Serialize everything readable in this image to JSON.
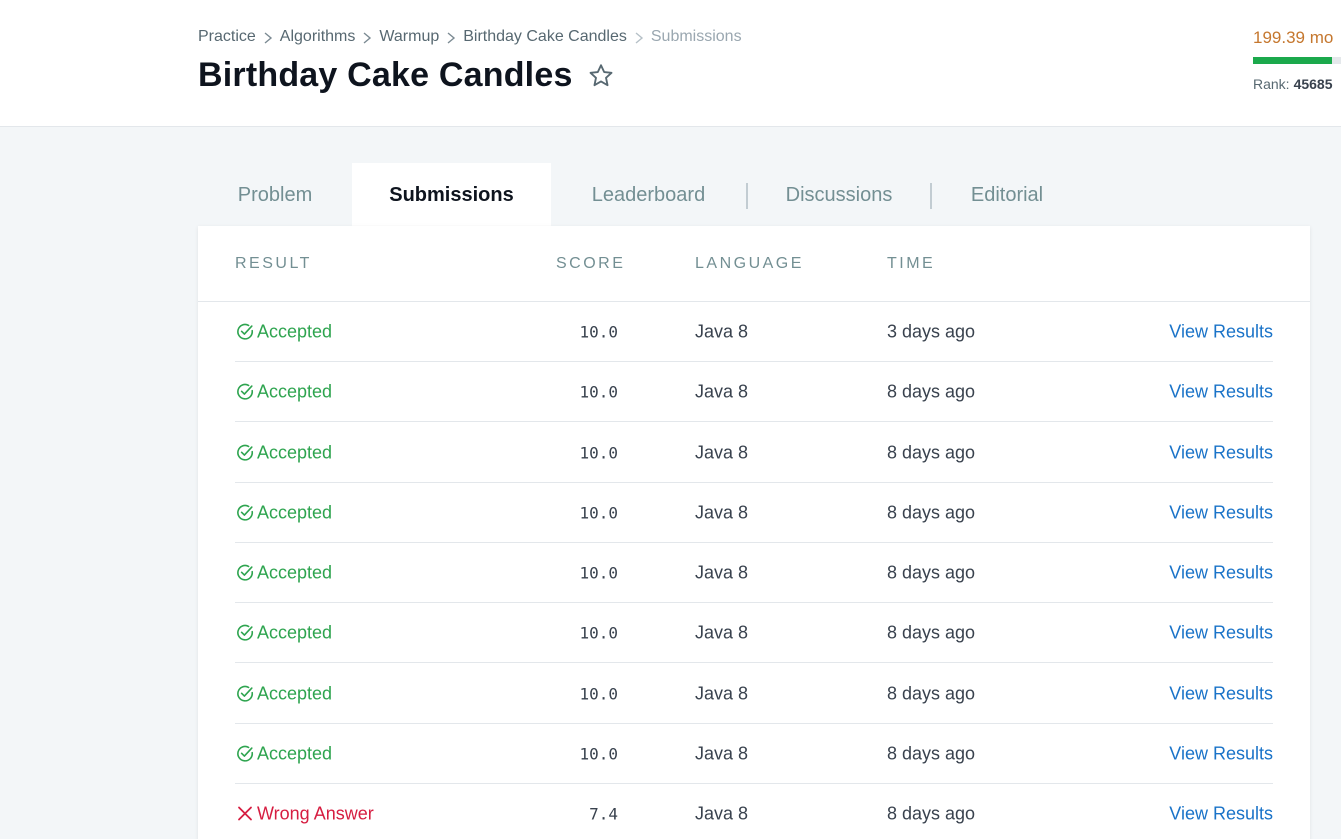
{
  "breadcrumb": [
    "Practice",
    "Algorithms",
    "Warmup",
    "Birthday Cake Candles",
    "Submissions"
  ],
  "page_title": "Birthday Cake Candles",
  "user_stats": {
    "points_text": "199.39 mo",
    "progress_fraction": 0.9,
    "rank_label": "Rank:",
    "rank_value": "45685"
  },
  "tabs": [
    {
      "label": "Problem",
      "active": false
    },
    {
      "label": "Submissions",
      "active": true
    },
    {
      "label": "Leaderboard",
      "active": false
    },
    {
      "label": "Discussions",
      "active": false
    },
    {
      "label": "Editorial",
      "active": false
    }
  ],
  "table": {
    "headers": [
      "RESULT",
      "SCORE",
      "LANGUAGE",
      "TIME"
    ],
    "rows": [
      {
        "result": "Accepted",
        "status": "accepted",
        "score": "10.0",
        "language": "Java 8",
        "time": "3 days ago",
        "action": "View Results"
      },
      {
        "result": "Accepted",
        "status": "accepted",
        "score": "10.0",
        "language": "Java 8",
        "time": "8 days ago",
        "action": "View Results"
      },
      {
        "result": "Accepted",
        "status": "accepted",
        "score": "10.0",
        "language": "Java 8",
        "time": "8 days ago",
        "action": "View Results"
      },
      {
        "result": "Accepted",
        "status": "accepted",
        "score": "10.0",
        "language": "Java 8",
        "time": "8 days ago",
        "action": "View Results"
      },
      {
        "result": "Accepted",
        "status": "accepted",
        "score": "10.0",
        "language": "Java 8",
        "time": "8 days ago",
        "action": "View Results"
      },
      {
        "result": "Accepted",
        "status": "accepted",
        "score": "10.0",
        "language": "Java 8",
        "time": "8 days ago",
        "action": "View Results"
      },
      {
        "result": "Accepted",
        "status": "accepted",
        "score": "10.0",
        "language": "Java 8",
        "time": "8 days ago",
        "action": "View Results"
      },
      {
        "result": "Accepted",
        "status": "accepted",
        "score": "10.0",
        "language": "Java 8",
        "time": "8 days ago",
        "action": "View Results"
      },
      {
        "result": "Wrong Answer",
        "status": "wrong",
        "score": "7.4",
        "language": "Java 8",
        "time": "8 days ago",
        "action": "View Results"
      }
    ]
  },
  "colors": {
    "accepted": "#2ea44f",
    "wrong": "#d61d41",
    "link": "#1a73c8",
    "points": "#c5772e",
    "progress": "#1ba94c"
  },
  "icons": {
    "breadcrumb_separator": "chevron-right-icon",
    "favorite": "star-outline-icon",
    "accepted": "check-circle-icon",
    "wrong": "x-icon"
  }
}
